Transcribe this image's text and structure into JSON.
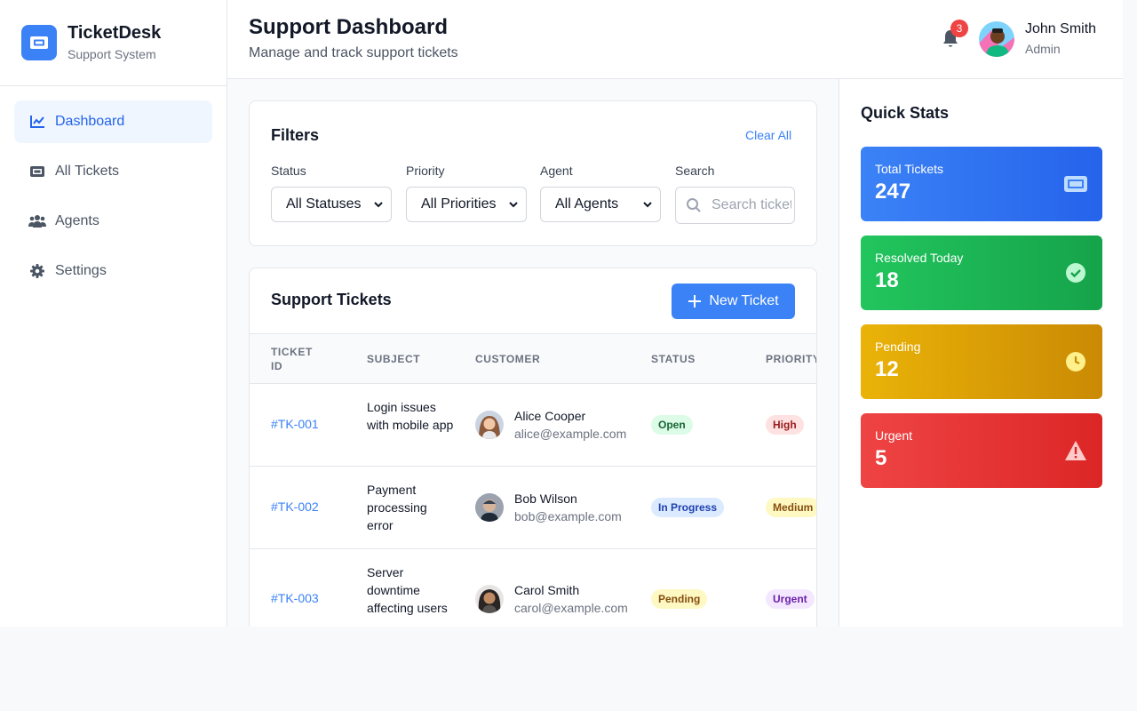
{
  "brand": {
    "name": "TicketDesk",
    "subtitle": "Support System",
    "icon": "ticket-icon"
  },
  "nav": [
    {
      "label": "Dashboard",
      "icon": "chart-line-icon",
      "active": true
    },
    {
      "label": "All Tickets",
      "icon": "ticket-icon",
      "active": false
    },
    {
      "label": "Agents",
      "icon": "users-icon",
      "active": false
    },
    {
      "label": "Settings",
      "icon": "gear-icon",
      "active": false
    }
  ],
  "header": {
    "title": "Support Dashboard",
    "subtitle": "Manage and track support tickets",
    "notifications": "3",
    "user": {
      "name": "John Smith",
      "role": "Admin"
    }
  },
  "filters": {
    "title": "Filters",
    "clear_label": "Clear All",
    "status": {
      "label": "Status",
      "value": "All Statuses"
    },
    "priority": {
      "label": "Priority",
      "value": "All Priorities"
    },
    "agent": {
      "label": "Agent",
      "value": "All Agents"
    },
    "search": {
      "label": "Search",
      "placeholder": "Search tickets..."
    }
  },
  "tickets": {
    "title": "Support Tickets",
    "new_label": "New Ticket",
    "columns": [
      "Ticket ID",
      "Subject",
      "Customer",
      "Status",
      "Priority"
    ],
    "rows": [
      {
        "id": "#TK-001",
        "subject": "Login issues with mobile app",
        "customer": "Alice Cooper",
        "email": "alice@example.com",
        "status": "Open",
        "priority": "High"
      },
      {
        "id": "#TK-002",
        "subject": "Payment processing error",
        "customer": "Bob Wilson",
        "email": "bob@example.com",
        "status": "In Progress",
        "priority": "Medium"
      },
      {
        "id": "#TK-003",
        "subject": "Server downtime affecting users",
        "customer": "Carol Smith",
        "email": "carol@example.com",
        "status": "Pending",
        "priority": "Urgent"
      }
    ]
  },
  "quick_stats": {
    "title": "Quick Stats",
    "items": [
      {
        "label": "Total Tickets",
        "value": "247",
        "icon": "ticket-icon"
      },
      {
        "label": "Resolved Today",
        "value": "18",
        "icon": "check-circle-icon"
      },
      {
        "label": "Pending",
        "value": "12",
        "icon": "clock-icon"
      },
      {
        "label": "Urgent",
        "value": "5",
        "icon": "warning-icon"
      }
    ]
  },
  "colors": {
    "accent": "#3b82f6",
    "blue": "#2563eb",
    "green": "#16a34a",
    "amber": "#ca8a04",
    "red": "#dc2626"
  }
}
